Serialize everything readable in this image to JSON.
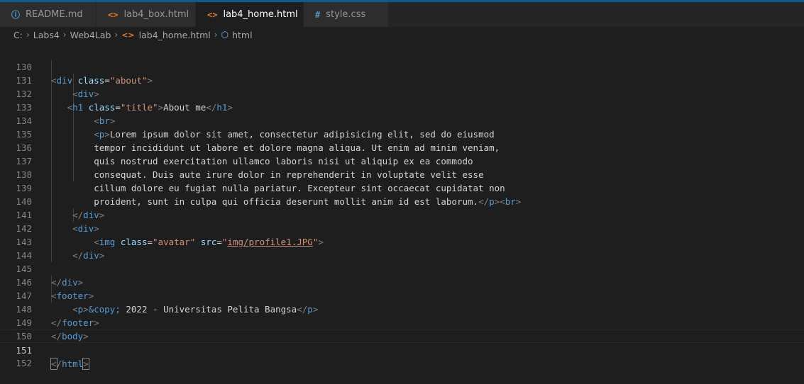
{
  "tabs": [
    {
      "label": "README.md",
      "icon": "info-icon",
      "active": false
    },
    {
      "label": "lab4_box.html",
      "icon": "html-file-icon",
      "active": false
    },
    {
      "label": "lab4_home.html",
      "icon": "html-file-icon",
      "active": true
    },
    {
      "label": "style.css",
      "icon": "css-file-icon",
      "active": false
    }
  ],
  "breadcrumb": {
    "drive": "C:",
    "folder1": "Labs4",
    "folder2": "Web4Lab",
    "file": "lab4_home.html",
    "symbol": "html"
  },
  "editor": {
    "current_line": 151,
    "lines": [
      {
        "n": "130"
      },
      {
        "n": "131"
      },
      {
        "n": "132"
      },
      {
        "n": "133"
      },
      {
        "n": "134"
      },
      {
        "n": "135"
      },
      {
        "n": "136"
      },
      {
        "n": "137"
      },
      {
        "n": "138"
      },
      {
        "n": "139"
      },
      {
        "n": "140"
      },
      {
        "n": "141"
      },
      {
        "n": "142"
      },
      {
        "n": "143"
      },
      {
        "n": "144"
      },
      {
        "n": "145"
      },
      {
        "n": "146"
      },
      {
        "n": "147"
      },
      {
        "n": "148"
      },
      {
        "n": "149"
      },
      {
        "n": "150"
      },
      {
        "n": "151"
      },
      {
        "n": "152"
      }
    ],
    "text": {
      "div": "div",
      "class": "class",
      "about_val": "\"about\"",
      "h1": "h1",
      "title_val": "\"title\"",
      "about_me": "About me",
      "br": "br",
      "p": "p",
      "p1": "Lorem ipsum dolor sit amet, consectetur adipisicing elit, sed do eiusmod",
      "p2": "tempor incididunt ut labore et dolore magna aliqua. Ut enim ad minim veniam,",
      "p3": "quis nostrud exercitation ullamco laboris nisi ut aliquip ex ea commodo",
      "p4": "consequat. Duis aute irure dolor in reprehenderit in voluptate velit esse",
      "p5": "cillum dolore eu fugiat nulla pariatur. Excepteur sint occaecat cupidatat non",
      "p6": "proident, sunt in culpa qui officia deserunt mollit anim id est laborum.",
      "img": "img",
      "avatar_val": "\"avatar\"",
      "src": "src",
      "src_val": "img/profile1.JPG",
      "footer": "footer",
      "copy": "&copy;",
      "footer_text": " 2022 - Universitas Pelita Bangsa",
      "body": "body",
      "html": "html"
    }
  }
}
